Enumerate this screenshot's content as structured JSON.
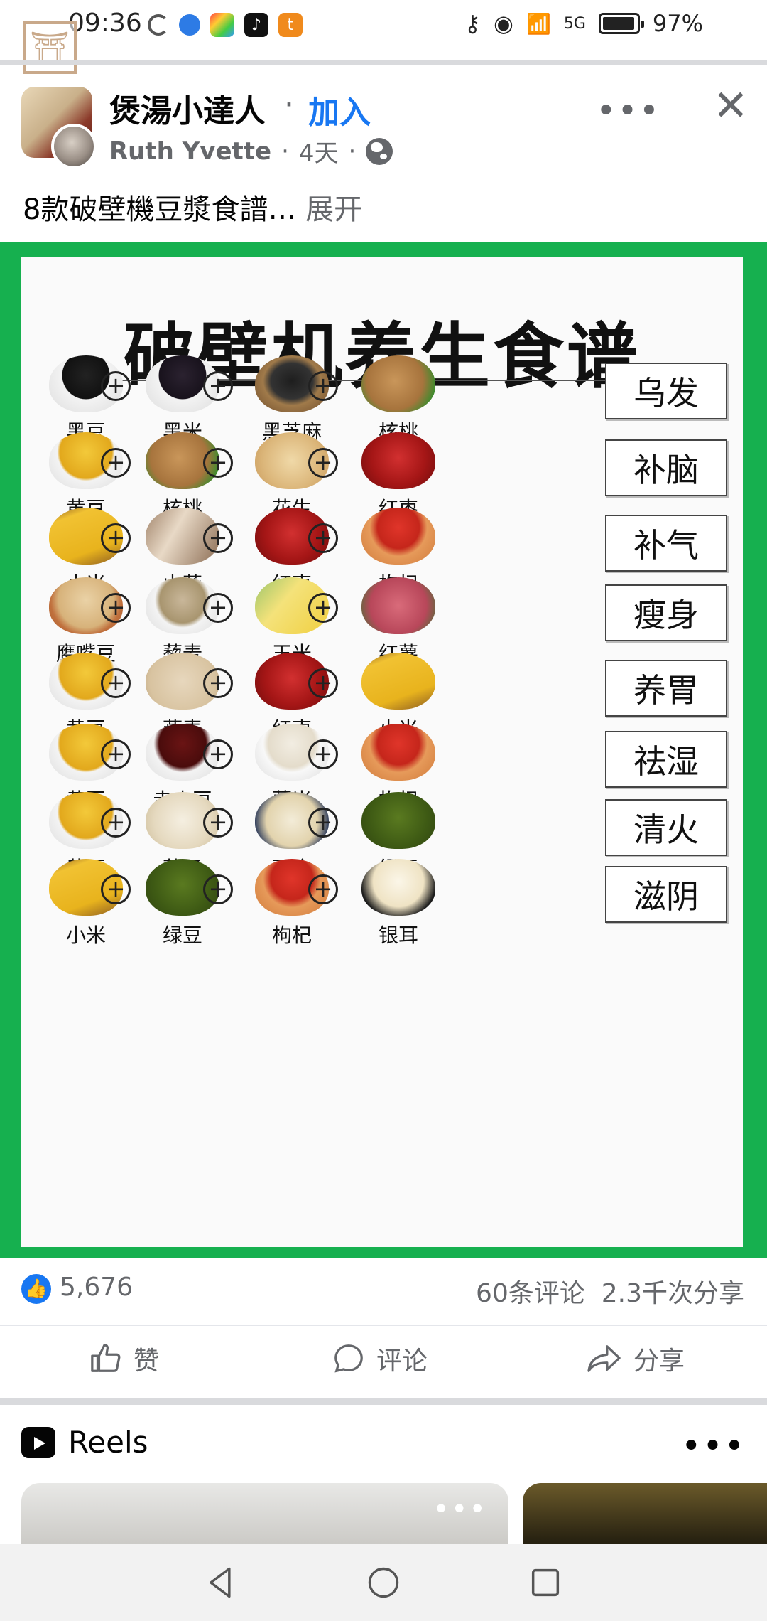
{
  "status_bar": {
    "time": "09:36",
    "battery": "97%",
    "battery_level": 0.97,
    "network": "5G"
  },
  "post": {
    "group_name": "煲湯小達人",
    "join_label": "加入",
    "author": "Ruth Yvette",
    "age": "4天",
    "text": "8款破壁機豆漿食譜…",
    "more_label": "展开"
  },
  "recipe": {
    "title": "破壁机养生食谱",
    "rows": [
      {
        "ingredients": [
          "黑豆",
          "黑米",
          "黑芝麻",
          "核桃"
        ],
        "benefit": "乌发"
      },
      {
        "ingredients": [
          "黄豆",
          "核桃",
          "花生",
          "红枣"
        ],
        "benefit": "补脑"
      },
      {
        "ingredients": [
          "小米",
          "山药",
          "红枣",
          "枸杞"
        ],
        "benefit": "补气"
      },
      {
        "ingredients": [
          "鹰嘴豆",
          "藜麦",
          "玉米",
          "红薯"
        ],
        "benefit": "瘦身"
      },
      {
        "ingredients": [
          "黄豆",
          "燕麦",
          "红枣",
          "小米"
        ],
        "benefit": "养胃"
      },
      {
        "ingredients": [
          "黄豆",
          "赤小豆",
          "薏米",
          "枸杞"
        ],
        "benefit": "祛湿"
      },
      {
        "ingredients": [
          "黄豆",
          "莲子",
          "百合",
          "绿豆"
        ],
        "benefit": "清火"
      },
      {
        "ingredients": [
          "小米",
          "绿豆",
          "枸杞",
          "银耳"
        ],
        "benefit": "滋阴"
      }
    ]
  },
  "engagement": {
    "likes": "5,676",
    "comments_shares": "60条评论  2.3千次分享"
  },
  "actions": {
    "like": "赞",
    "comment": "评论",
    "share": "分享"
  },
  "reels": {
    "title": "Reels"
  },
  "colors": {
    "brand_blue": "#1877f2",
    "recipe_green": "#16b04f"
  }
}
